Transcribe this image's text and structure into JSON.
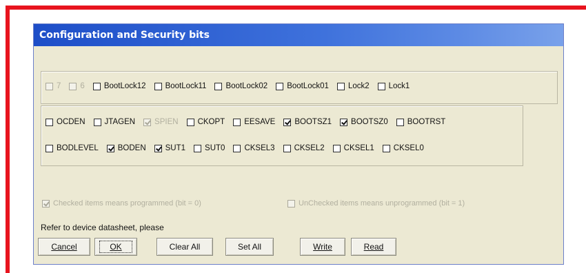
{
  "colors": {
    "frame_red": "#e8141e",
    "title_blue": "#1d4ec8",
    "dialog_bg": "#ece9d3"
  },
  "window": {
    "title": "Configuration and Security bits"
  },
  "lock_bits": [
    {
      "label": "7",
      "checked": false,
      "disabled": true
    },
    {
      "label": "6",
      "checked": false,
      "disabled": true
    },
    {
      "label": "BootLock12",
      "checked": false,
      "disabled": false
    },
    {
      "label": "BootLock11",
      "checked": false,
      "disabled": false
    },
    {
      "label": "BootLock02",
      "checked": false,
      "disabled": false
    },
    {
      "label": "BootLock01",
      "checked": false,
      "disabled": false
    },
    {
      "label": "Lock2",
      "checked": false,
      "disabled": false
    },
    {
      "label": "Lock1",
      "checked": false,
      "disabled": false
    }
  ],
  "fuse_row1": [
    {
      "label": "OCDEN",
      "checked": false,
      "disabled": false
    },
    {
      "label": "JTAGEN",
      "checked": false,
      "disabled": false
    },
    {
      "label": "SPIEN",
      "checked": true,
      "disabled": true
    },
    {
      "label": "CKOPT",
      "checked": false,
      "disabled": false
    },
    {
      "label": "EESAVE",
      "checked": false,
      "disabled": false
    },
    {
      "label": "BOOTSZ1",
      "checked": true,
      "disabled": false
    },
    {
      "label": "BOOTSZ0",
      "checked": true,
      "disabled": false
    },
    {
      "label": "BOOTRST",
      "checked": false,
      "disabled": false
    }
  ],
  "fuse_row2": [
    {
      "label": "BODLEVEL",
      "checked": false,
      "disabled": false
    },
    {
      "label": "BODEN",
      "checked": true,
      "disabled": false
    },
    {
      "label": "SUT1",
      "checked": true,
      "disabled": false
    },
    {
      "label": "SUT0",
      "checked": false,
      "disabled": false
    },
    {
      "label": "CKSEL3",
      "checked": false,
      "disabled": false
    },
    {
      "label": "CKSEL2",
      "checked": false,
      "disabled": false
    },
    {
      "label": "CKSEL1",
      "checked": false,
      "disabled": false
    },
    {
      "label": "CKSEL0",
      "checked": false,
      "disabled": false
    }
  ],
  "legend": {
    "checked_text": "Checked items means programmed (bit = 0)",
    "unchecked_text": "UnChecked items means unprogrammed (bit = 1)"
  },
  "hint": "Refer to device datasheet, please",
  "buttons": {
    "cancel": "Cancel",
    "ok": "OK",
    "clear_all": "Clear All",
    "set_all": "Set All",
    "write": "Write",
    "read": "Read"
  }
}
